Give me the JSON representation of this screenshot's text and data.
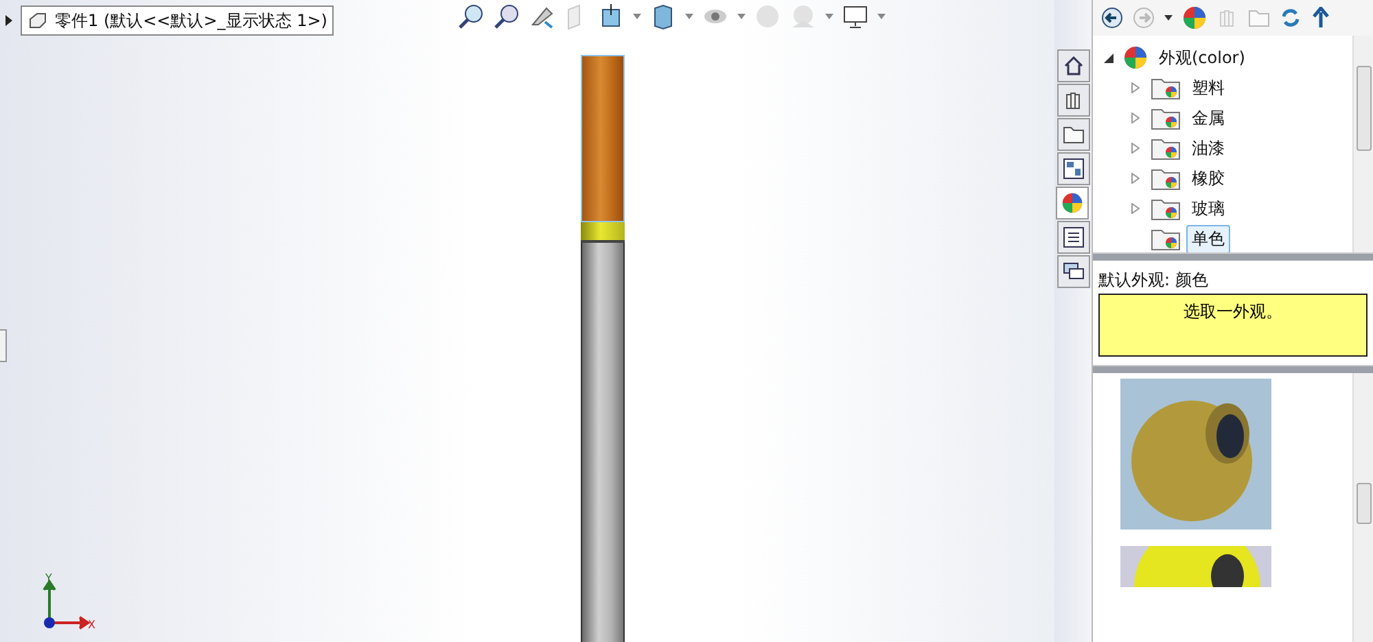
{
  "document": {
    "title": "零件1 (默认<<默认>_显示状态 1>)"
  },
  "tree": {
    "label": "外观(color)",
    "expanded": true,
    "children": [
      {
        "label": "塑料",
        "expandable": true,
        "selected": false
      },
      {
        "label": "金属",
        "expandable": true,
        "selected": false
      },
      {
        "label": "油漆",
        "expandable": true,
        "selected": false
      },
      {
        "label": "橡胶",
        "expandable": true,
        "selected": false
      },
      {
        "label": "玻璃",
        "expandable": true,
        "selected": false
      },
      {
        "label": "单色",
        "expandable": false,
        "selected": true
      }
    ]
  },
  "side_tabs": [
    {
      "kind": "home",
      "selected": false
    },
    {
      "kind": "library",
      "selected": false
    },
    {
      "kind": "folder",
      "selected": false
    },
    {
      "kind": "palette",
      "selected": false
    },
    {
      "kind": "appearance",
      "selected": true
    },
    {
      "kind": "list",
      "selected": false
    },
    {
      "kind": "chat",
      "selected": false
    }
  ],
  "triad": {
    "y_label": "Y",
    "x_label": "X"
  },
  "appearance": {
    "label": "默认外观: 颜色",
    "message": "选取一外观。"
  }
}
